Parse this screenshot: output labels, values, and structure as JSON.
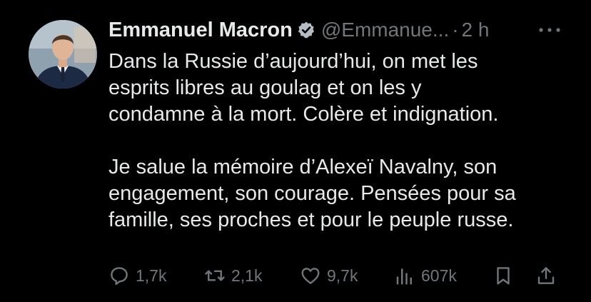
{
  "tweet": {
    "author_name": "Emmanuel Macron",
    "handle": "@Emmanue...",
    "separator": "·",
    "time": "2 h",
    "verified": true,
    "text_lines": [
      "Dans la Russie d’aujourd’hui, on met les",
      "esprits libres au goulag et on les y",
      "condamne à la mort. Colère et indignation.",
      "",
      "Je salue la mémoire d’Alexeï Navalny, son",
      "engagement, son courage. Pensées pour sa",
      "famille, ses proches et pour le peuple russe."
    ]
  },
  "actions": {
    "replies": "1,7k",
    "reposts": "2,1k",
    "likes": "9,7k",
    "views": "607k"
  },
  "colors": {
    "background": "#000000",
    "primary_text": "#e7e9ea",
    "secondary_text": "#71767b",
    "verified_badge": "#1d9bf0"
  },
  "icons": [
    "verified-badge-icon",
    "more-icon",
    "reply-icon",
    "repost-icon",
    "like-icon",
    "views-icon",
    "bookmark-icon",
    "share-icon"
  ]
}
